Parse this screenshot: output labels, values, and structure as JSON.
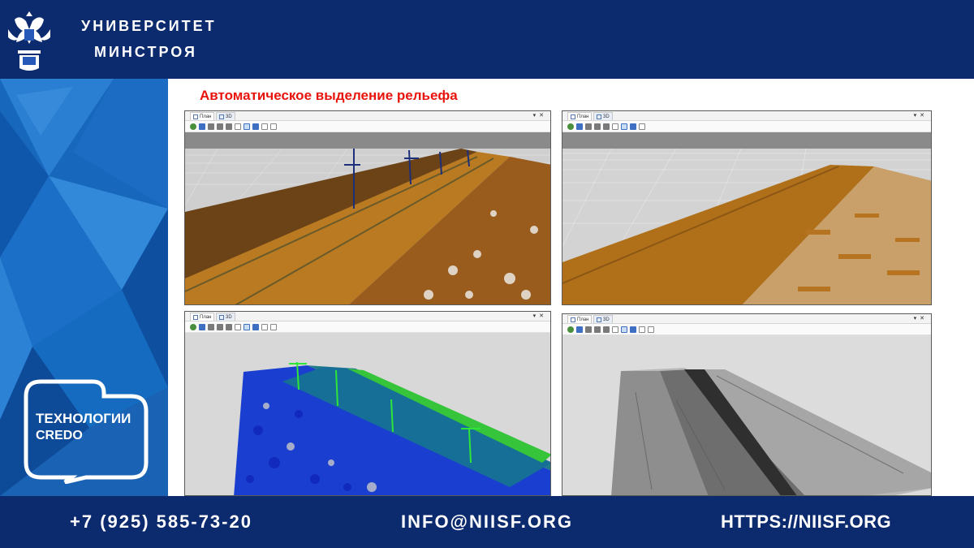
{
  "header": {
    "org_line1": "УНИВЕРСИТЕТ",
    "org_line2": "МИНСТРОЯ",
    "emblem_icon": "double-headed-eagle-emblem"
  },
  "slide": {
    "title": "Автоматическое выделение рельефа"
  },
  "brand": {
    "line1": "ТЕХНОЛОГИИ",
    "line2": "CREDO"
  },
  "windows": [
    {
      "tabs": [
        {
          "label": "План"
        },
        {
          "label": "3D"
        }
      ],
      "view": "point-cloud-natural-colors"
    },
    {
      "tabs": [
        {
          "label": "План"
        },
        {
          "label": "3D"
        }
      ],
      "view": "ground-surface-extracted"
    },
    {
      "tabs": [
        {
          "label": "План"
        },
        {
          "label": "3D"
        }
      ],
      "view": "point-cloud-height-colored"
    },
    {
      "tabs": [
        {
          "label": "План"
        },
        {
          "label": "3D"
        }
      ],
      "view": "relief-grayscale-shaded"
    }
  ],
  "footer": {
    "phone": "+7 (925) 585-73-20",
    "email": "INFO@NIISF.ORG",
    "url": "HTTPS://NIISF.ORG"
  },
  "colors": {
    "navy": "#0c2a6e",
    "blue_band": "#1a73c9",
    "title_red": "#e8140c",
    "terrain_brown": "#b8731c"
  }
}
